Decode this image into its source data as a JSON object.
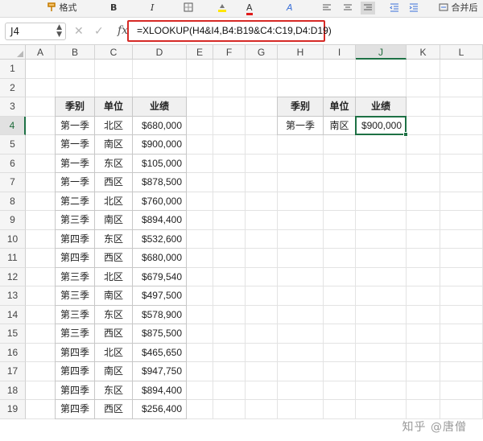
{
  "ribbon": {
    "format_label": "格式",
    "bold_label": "B",
    "italic_label": "I",
    "font_color_label": "A",
    "font_size_label": "A",
    "merge_label": "合并后"
  },
  "formula_bar": {
    "name_box": "J4",
    "fx_label": "fx",
    "cancel_symbol": "✕",
    "accept_symbol": "✓",
    "formula": "=XLOOKUP(H4&I4,B4:B19&C4:C19,D4:D19)",
    "highlight_color": "#d62a26"
  },
  "grid": {
    "columns": [
      "A",
      "B",
      "C",
      "D",
      "E",
      "F",
      "G",
      "H",
      "I",
      "J",
      "K",
      "L"
    ],
    "rows": [
      "1",
      "2",
      "3",
      "4",
      "5",
      "6",
      "7",
      "8",
      "9",
      "10",
      "11",
      "12",
      "13",
      "14",
      "15",
      "16",
      "17",
      "18",
      "19"
    ],
    "selected_column": "J",
    "selected_row": "4",
    "selection_color": "#1e7145"
  },
  "source_table": {
    "headers": [
      "季别",
      "单位",
      "业绩"
    ],
    "rows": [
      [
        "第一季",
        "北区",
        "$680,000"
      ],
      [
        "第一季",
        "南区",
        "$900,000"
      ],
      [
        "第一季",
        "东区",
        "$105,000"
      ],
      [
        "第一季",
        "西区",
        "$878,500"
      ],
      [
        "第二季",
        "北区",
        "$760,000"
      ],
      [
        "第三季",
        "南区",
        "$894,400"
      ],
      [
        "第四季",
        "东区",
        "$532,600"
      ],
      [
        "第四季",
        "西区",
        "$680,000"
      ],
      [
        "第三季",
        "北区",
        "$679,540"
      ],
      [
        "第三季",
        "南区",
        "$497,500"
      ],
      [
        "第三季",
        "东区",
        "$578,900"
      ],
      [
        "第三季",
        "西区",
        "$875,500"
      ],
      [
        "第四季",
        "北区",
        "$465,650"
      ],
      [
        "第四季",
        "南区",
        "$947,750"
      ],
      [
        "第四季",
        "东区",
        "$894,400"
      ],
      [
        "第四季",
        "西区",
        "$256,400"
      ]
    ]
  },
  "lookup_table": {
    "headers": [
      "季别",
      "单位",
      "业绩"
    ],
    "row": [
      "第一季",
      "南区",
      "$900,000"
    ]
  },
  "watermark": "知乎 @唐僧"
}
